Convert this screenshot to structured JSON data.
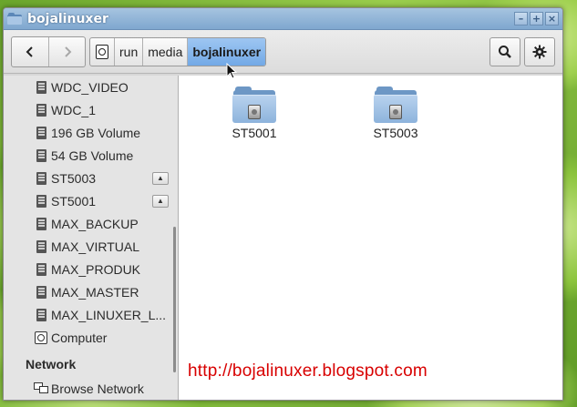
{
  "window": {
    "title": "bojalinuxer",
    "controls": [
      "minimize",
      "maximize",
      "close"
    ]
  },
  "toolbar": {
    "back_icon": "chevron-left",
    "forward_icon": "chevron-right",
    "path": [
      {
        "label": "",
        "icon": "drive-icon"
      },
      {
        "label": "run"
      },
      {
        "label": "media"
      },
      {
        "label": "bojalinuxer",
        "active": true
      }
    ],
    "search_icon": "search-icon",
    "settings_icon": "gear-icon"
  },
  "sidebar": {
    "devices": [
      {
        "label": "WDC_VIDEO"
      },
      {
        "label": "WDC_1"
      },
      {
        "label": "196 GB Volume"
      },
      {
        "label": "54 GB Volume"
      },
      {
        "label": "ST5003",
        "eject": true
      },
      {
        "label": "ST5001",
        "eject": true
      },
      {
        "label": "MAX_BACKUP"
      },
      {
        "label": "MAX_VIRTUAL"
      },
      {
        "label": "MAX_PRODUK"
      },
      {
        "label": "MAX_MASTER"
      },
      {
        "label": "MAX_LINUXER_L..."
      },
      {
        "label": "Computer"
      }
    ],
    "network_heading": "Network",
    "network_items": [
      {
        "label": "Browse Network"
      }
    ]
  },
  "content": {
    "items": [
      {
        "label": "ST5001"
      },
      {
        "label": "ST5003"
      }
    ],
    "watermark": "http://bojalinuxer.blogspot.com"
  },
  "colors": {
    "titlebar": "#8fb3d8",
    "active_path": "#86b7ec",
    "watermark": "#d80000"
  }
}
